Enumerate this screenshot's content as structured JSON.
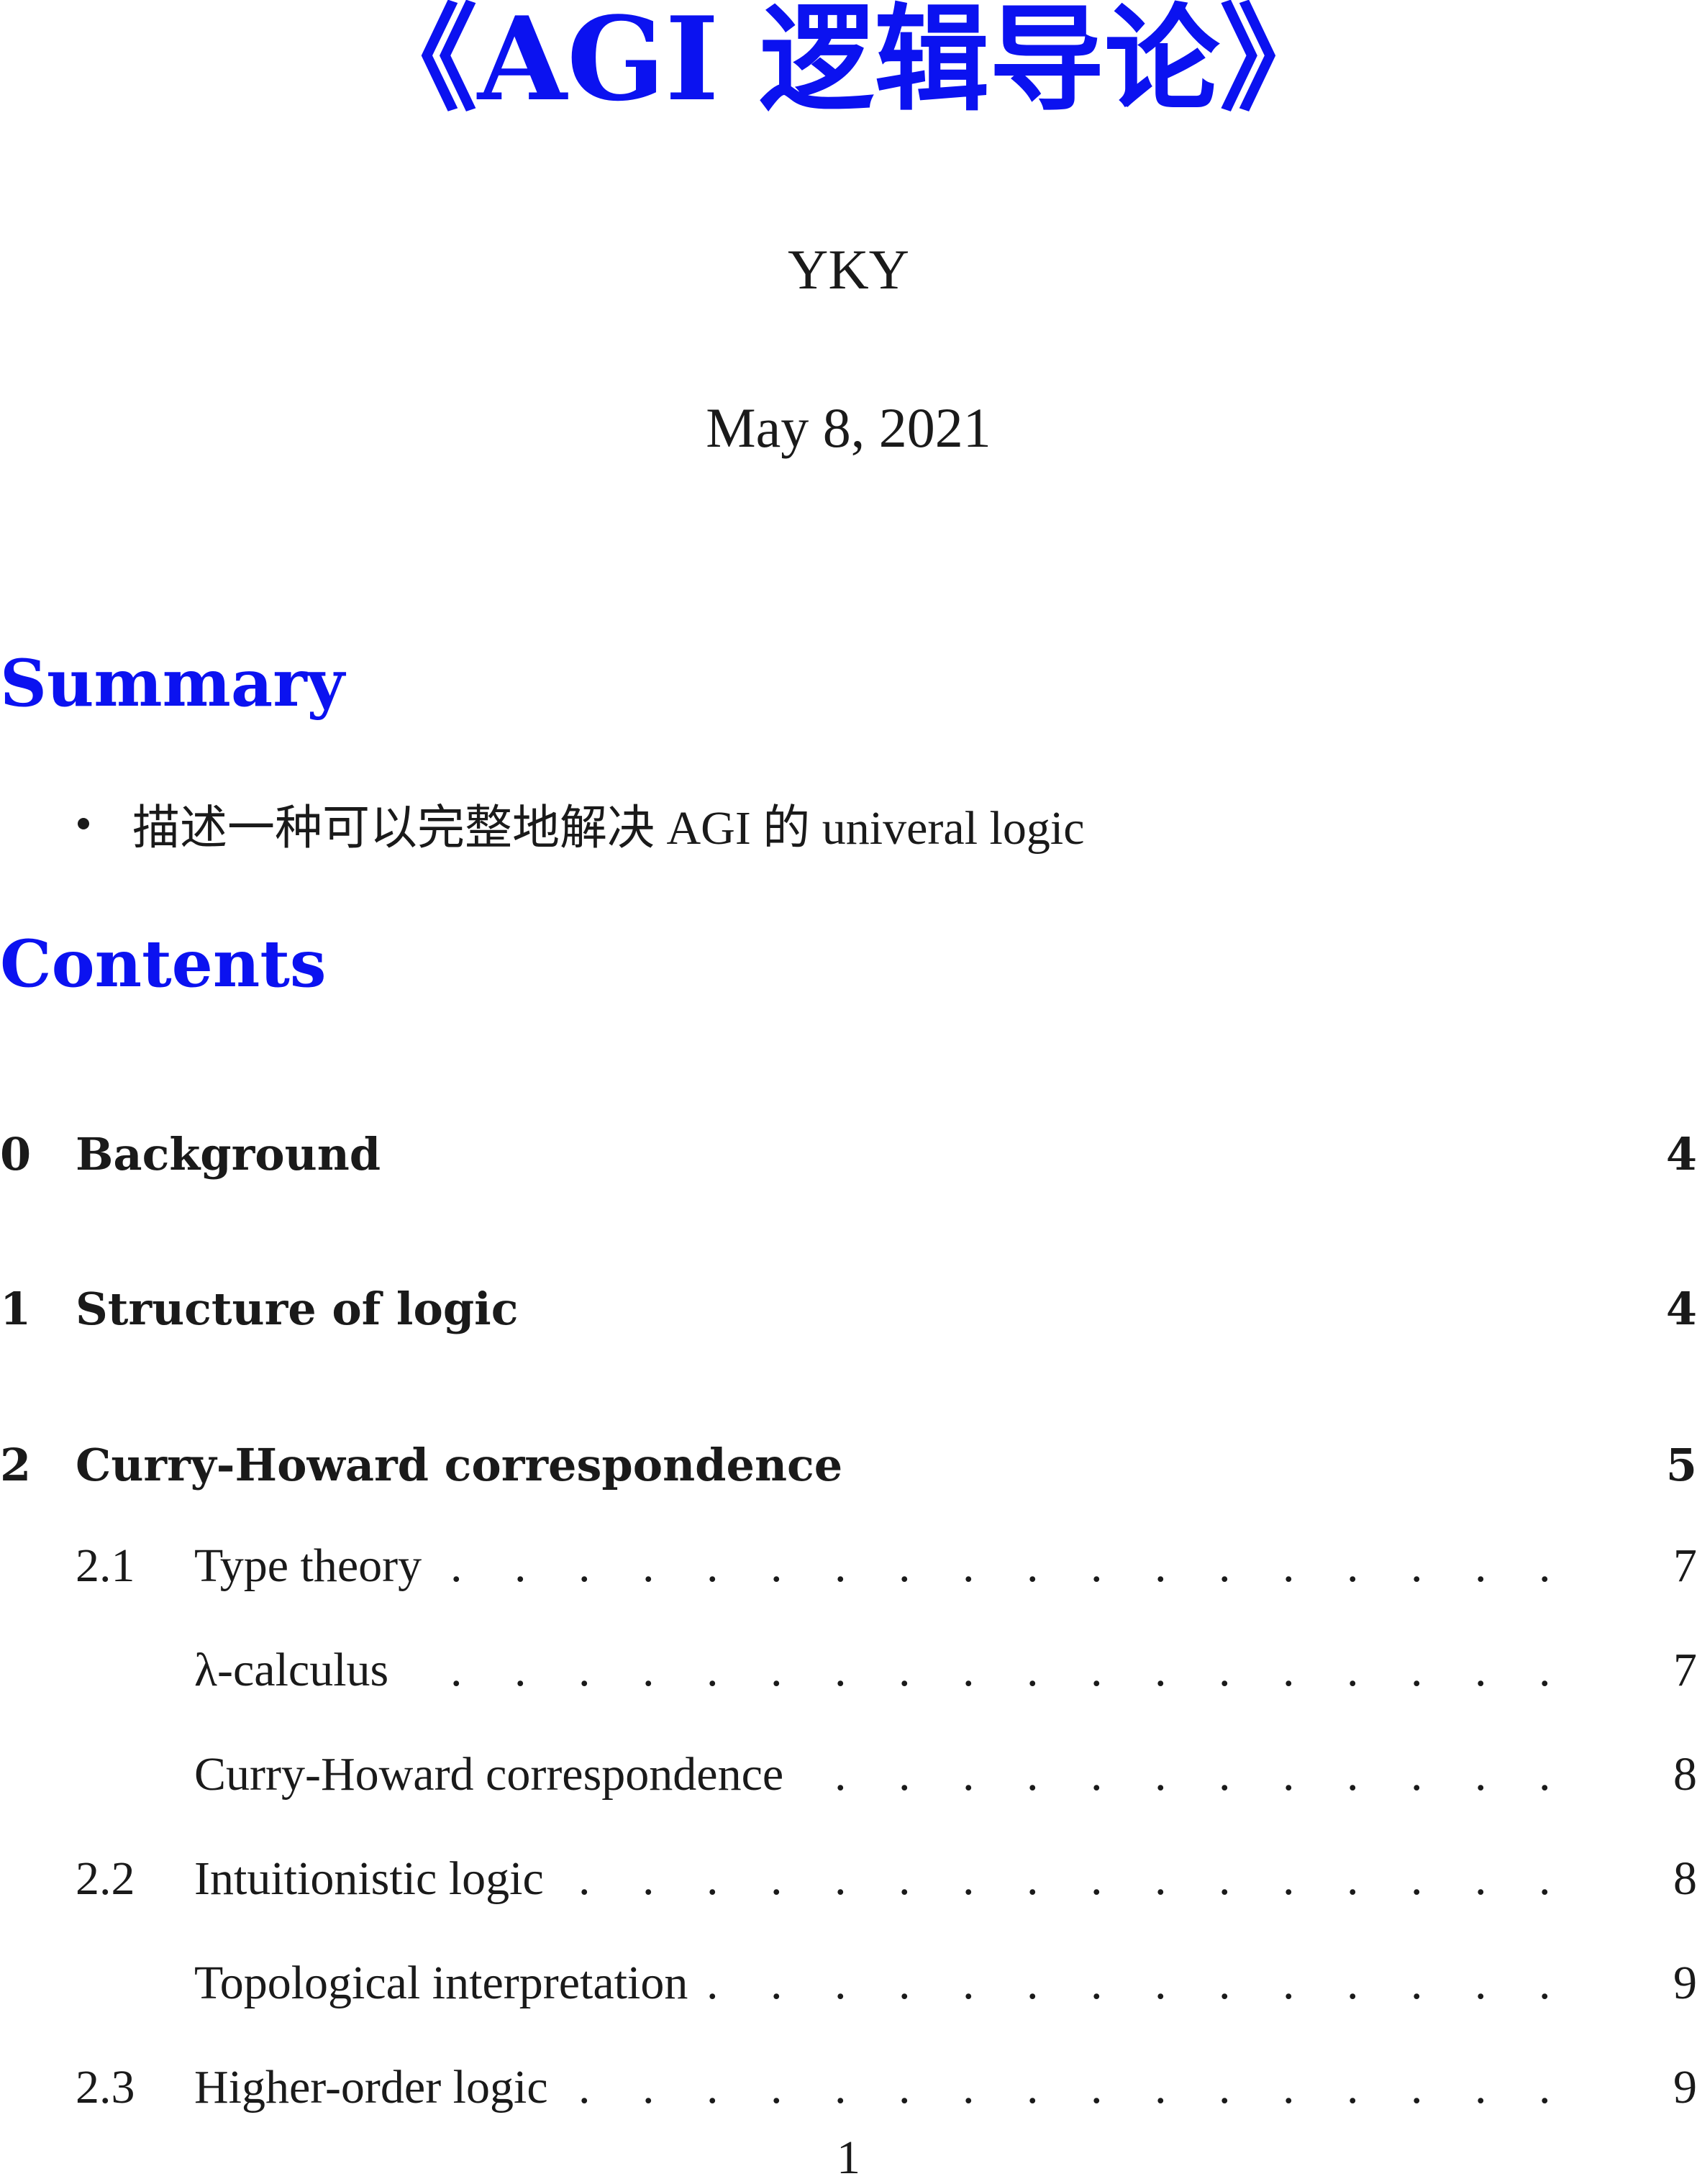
{
  "document": {
    "title": "《AGI 逻辑导论》",
    "author": "YKY",
    "date": "May 8, 2021",
    "summary_heading": "Summary",
    "summary_items": [
      "描述一种可以完整地解决 AGI 的 univeral logic"
    ],
    "contents_heading": "Contents",
    "toc": [
      {
        "num": "0",
        "label": "Background",
        "page": "4"
      },
      {
        "num": "1",
        "label": "Structure of logic",
        "page": "4"
      },
      {
        "num": "2",
        "label": "Curry-Howard correspondence",
        "page": "5"
      },
      {
        "num": "2.1",
        "label": "Type theory",
        "page": "7"
      },
      {
        "num": "",
        "label": "λ-calculus",
        "page": "7"
      },
      {
        "num": "",
        "label": "Curry-Howard correspondence",
        "page": "8"
      },
      {
        "num": "2.2",
        "label": "Intuitionistic logic",
        "page": "8"
      },
      {
        "num": "",
        "label": "Topological interpretation",
        "page": "9"
      },
      {
        "num": "2.3",
        "label": "Higher-order logic",
        "page": "9"
      }
    ],
    "page_number": "1",
    "colors": {
      "heading_blue": "#0b12f0",
      "text": "#1a1a1a"
    }
  }
}
